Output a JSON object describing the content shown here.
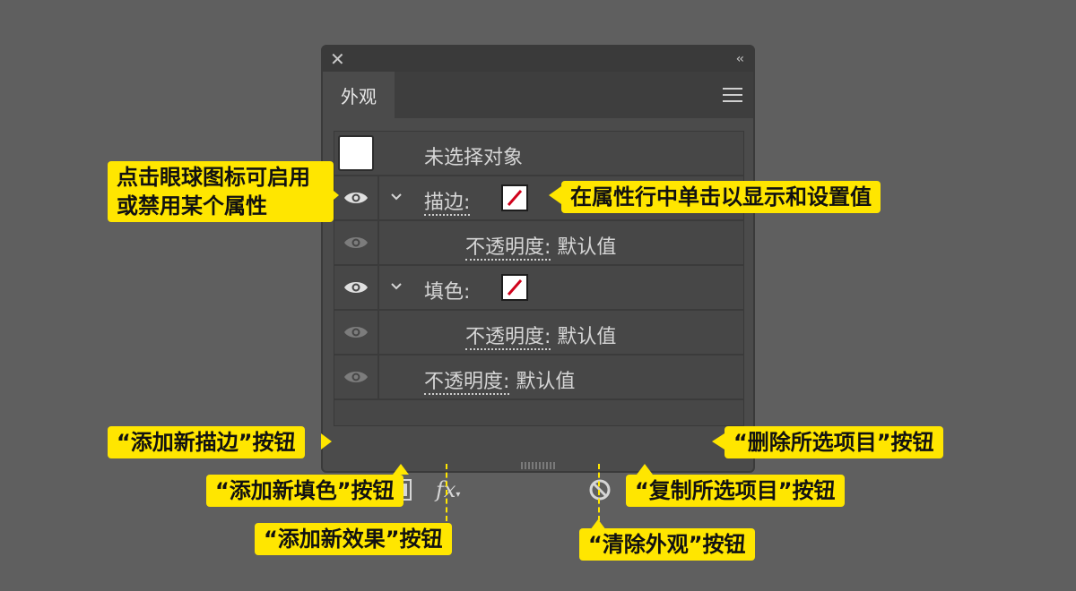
{
  "panel": {
    "close_glyph": "✕",
    "collapse_glyph": "‹‹",
    "tab_label": "外观",
    "rows": {
      "object": "未选择对象",
      "stroke_label": "描边:",
      "stroke_opacity_label": "不透明度:",
      "stroke_opacity_value": "默认值",
      "fill_label": "填色:",
      "fill_opacity_label": "不透明度:",
      "fill_opacity_value": "默认值",
      "opacity_label": "不透明度:",
      "opacity_value": "默认值"
    },
    "fx_label": "fx"
  },
  "callouts": {
    "eye": "点击眼球图标可启用或禁用某个属性",
    "property_row": "在属性行中单击以显示和设置值",
    "add_stroke": "“添加新描边”按钮",
    "add_fill": "“添加新填色”按钮",
    "add_effect": "“添加新效果”按钮",
    "delete_item": "“删除所选项目”按钮",
    "duplicate_item": "“复制所选项目”按钮",
    "clear_appearance": "“清除外观”按钮"
  },
  "colors": {
    "callout": "#ffe600",
    "panel": "#4b4b4b",
    "swatch_slash": "#d0021b"
  }
}
